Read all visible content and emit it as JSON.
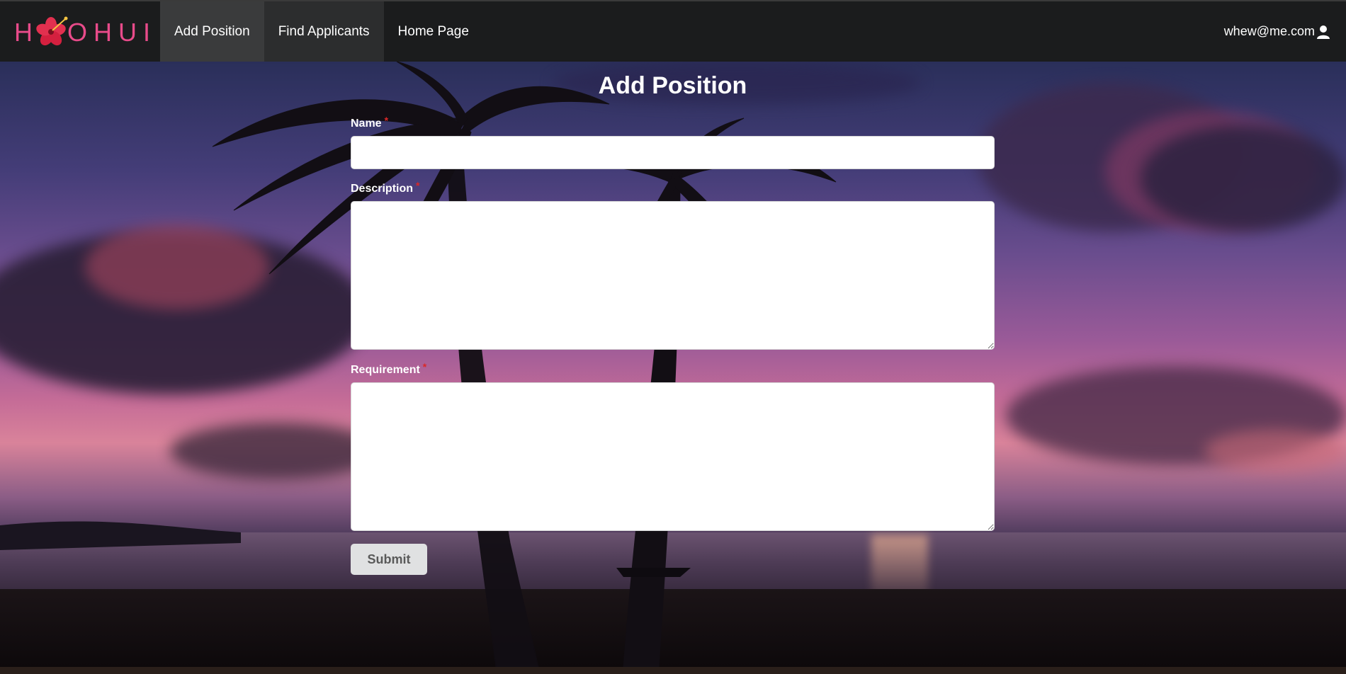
{
  "brand": {
    "logo_text": "HOOHUI",
    "accent": "#e84b8a"
  },
  "nav": {
    "items": [
      {
        "label": "Add Position",
        "active": true
      },
      {
        "label": "Find Applicants",
        "active": false
      },
      {
        "label": "Home Page",
        "active": false
      }
    ],
    "user_email": "whew@me.com",
    "user_icon": "user-icon"
  },
  "form": {
    "title": "Add Position",
    "fields": {
      "name": {
        "label": "Name",
        "value": "",
        "required_mark": "*"
      },
      "description": {
        "label": "Description",
        "value": "",
        "required_mark": "*"
      },
      "requirement": {
        "label": "Requirement",
        "value": "",
        "required_mark": "*"
      }
    },
    "submit_label": "Submit"
  },
  "colors": {
    "navbar": "#1b1c1d",
    "active_nav": "#3a3b3c",
    "required": "#db2828",
    "button": "#e0e1e2"
  }
}
